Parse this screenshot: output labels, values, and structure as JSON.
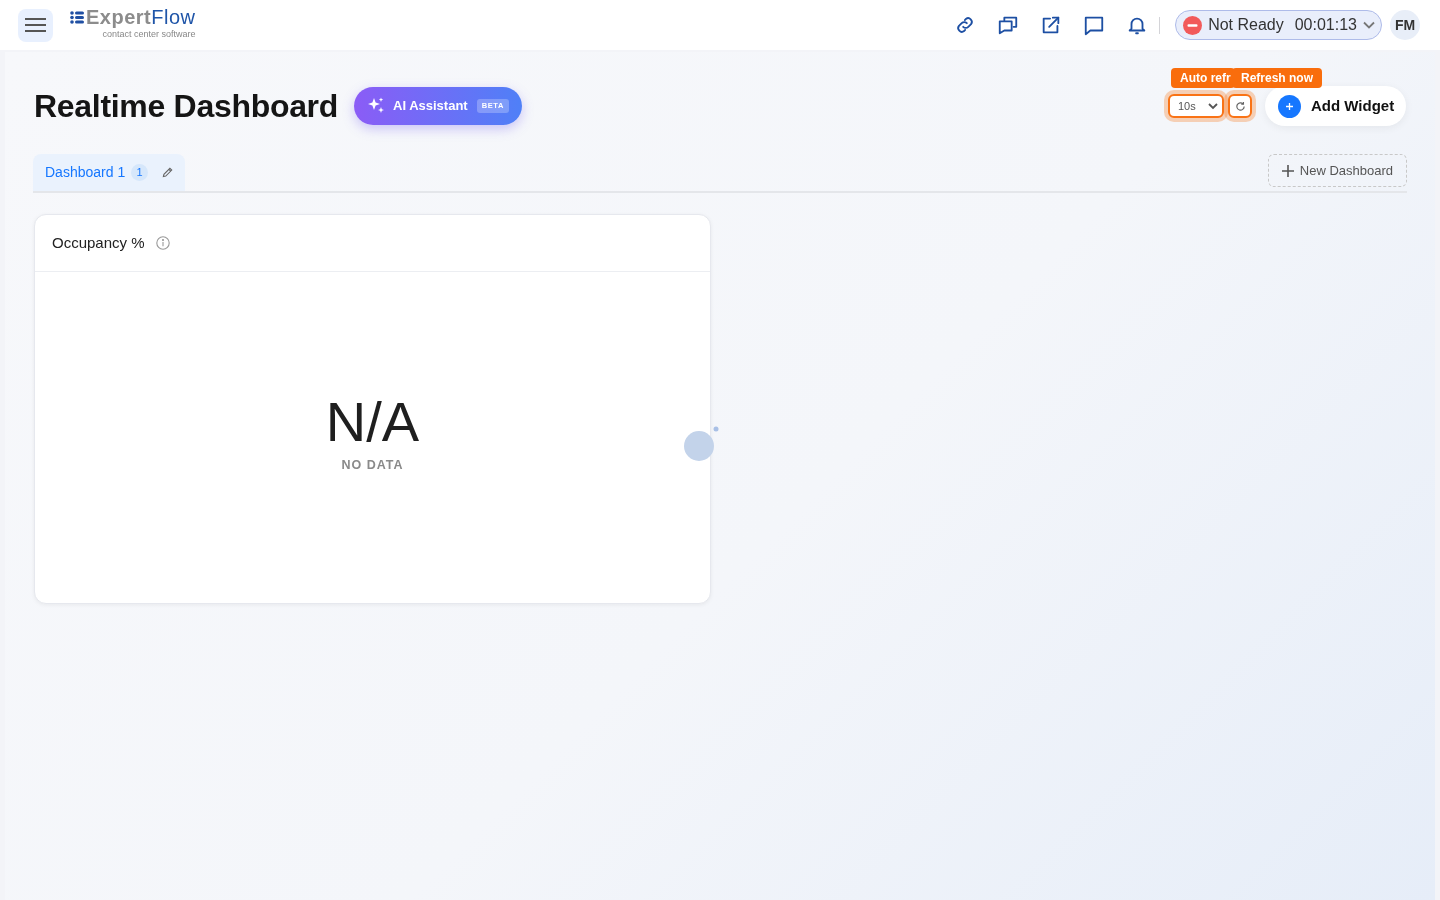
{
  "header": {
    "logo": {
      "brand_first": "Expert",
      "brand_second": "Flow",
      "tagline": "contact center software"
    },
    "status": {
      "label": "Not Ready",
      "timer": "00:01:13"
    },
    "avatar": {
      "initials": "FM"
    }
  },
  "page": {
    "title": "Realtime Dashboard",
    "ai_button": {
      "label": "AI Assistant",
      "badge": "BETA"
    }
  },
  "refresh": {
    "interval": "10s",
    "tooltips": [
      "Auto refr",
      "Refresh now"
    ]
  },
  "add_widget": {
    "label": "Add Widget"
  },
  "tabs": [
    {
      "label": "Dashboard 1",
      "count": "1",
      "selected": true
    }
  ],
  "new_dashboard": {
    "label": "New Dashboard"
  },
  "widgets": [
    {
      "title": "Occupancy %",
      "value": "N/A",
      "caption": "NO DATA"
    }
  ]
}
